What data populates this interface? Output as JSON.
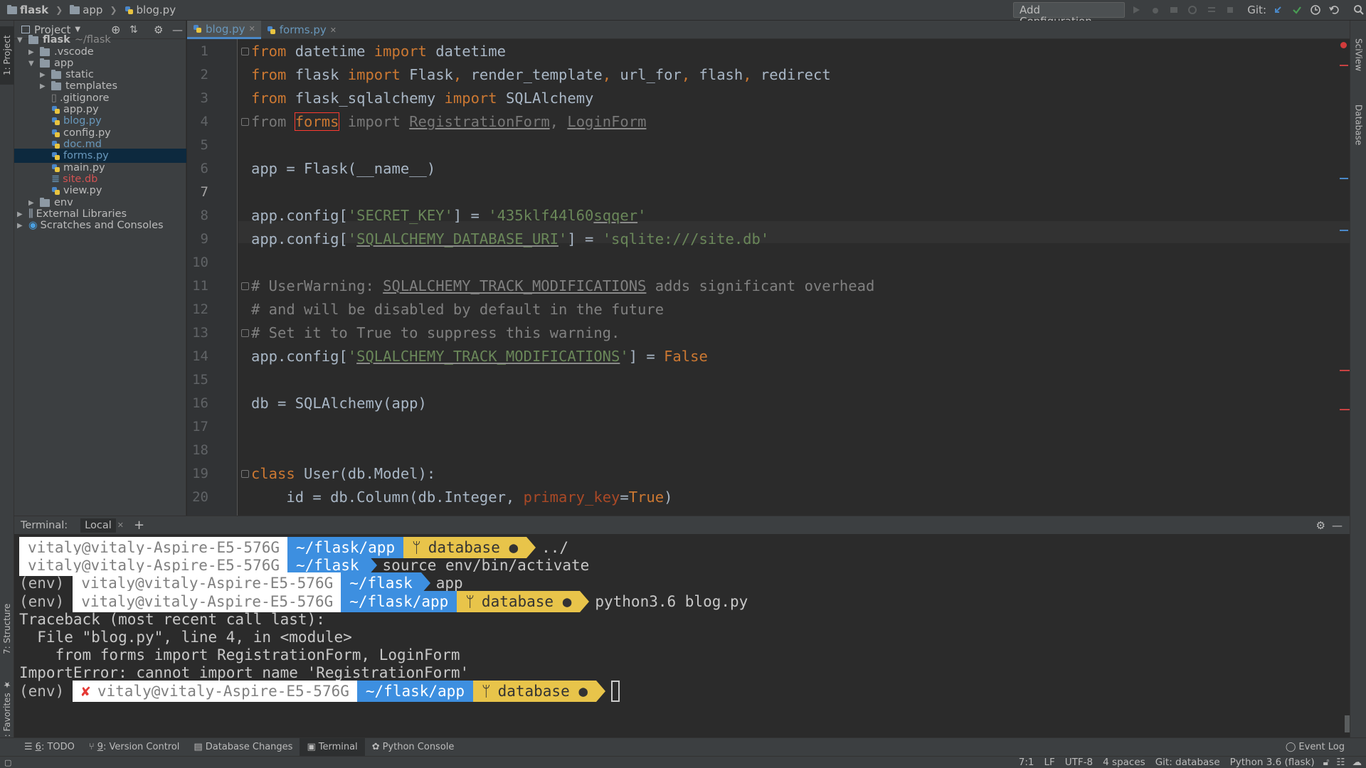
{
  "breadcrumb": {
    "root": "flask",
    "folder": "app",
    "file": "blog.py"
  },
  "nav": {
    "run_config": "Add Configuration...",
    "git_label": "Git:"
  },
  "project": {
    "header": "Project",
    "tree": [
      {
        "label": "flask",
        "suffix": "~/flask",
        "kind": "folder",
        "depth": 0,
        "expanded": true
      },
      {
        "label": ".vscode",
        "kind": "folder",
        "depth": 1,
        "expanded": false
      },
      {
        "label": "app",
        "kind": "folder",
        "depth": 1,
        "expanded": true
      },
      {
        "label": "static",
        "kind": "folder",
        "depth": 2,
        "expanded": false
      },
      {
        "label": "templates",
        "kind": "folder",
        "depth": 2,
        "expanded": false
      },
      {
        "label": ".gitignore",
        "kind": "file",
        "depth": 2
      },
      {
        "label": "app.py",
        "kind": "py",
        "depth": 2
      },
      {
        "label": "blog.py",
        "kind": "py",
        "depth": 2,
        "color": "#6897bb"
      },
      {
        "label": "config.py",
        "kind": "py",
        "depth": 2
      },
      {
        "label": "doc.md",
        "kind": "md",
        "depth": 2,
        "color": "#6897bb"
      },
      {
        "label": "forms.py",
        "kind": "py",
        "depth": 2,
        "color": "#6897bb",
        "selected": true
      },
      {
        "label": "main.py",
        "kind": "py",
        "depth": 2
      },
      {
        "label": "site.db",
        "kind": "db",
        "depth": 2,
        "color": "#d25252"
      },
      {
        "label": "view.py",
        "kind": "py",
        "depth": 2
      },
      {
        "label": "env",
        "kind": "folder",
        "depth": 1,
        "expanded": false
      },
      {
        "label": "External Libraries",
        "kind": "lib",
        "depth": 0,
        "expanded": false
      },
      {
        "label": "Scratches and Consoles",
        "kind": "scratch",
        "depth": 0,
        "expanded": false
      }
    ]
  },
  "tabs": [
    {
      "label": "blog.py",
      "active": true
    },
    {
      "label": "forms.py",
      "active": false
    }
  ],
  "editor": {
    "line_numbers": [
      "1",
      "2",
      "3",
      "4",
      "5",
      "6",
      "7",
      "8",
      "9",
      "10",
      "11",
      "12",
      "13",
      "14",
      "15",
      "16",
      "17",
      "18",
      "19",
      "20"
    ],
    "current_line": 7,
    "code": {
      "l1": [
        "from",
        " datetime ",
        "import",
        " datetime"
      ],
      "l2": [
        "from",
        " flask ",
        "import",
        " Flask",
        ",",
        " render_template",
        ",",
        " url_for",
        ",",
        " flash",
        ",",
        " redirect"
      ],
      "l3": [
        "from",
        " flask_sqlalchemy ",
        "import",
        " SQLAlchemy"
      ],
      "l4": [
        "from",
        " ",
        "forms",
        " import ",
        "RegistrationForm",
        ", ",
        "LoginForm"
      ],
      "l6": [
        "app = Flask(",
        "__name__",
        ")"
      ],
      "l8": [
        "app.config[",
        "'SECRET_KEY'",
        "] = ",
        "'435klf44l60",
        "sqqer",
        "'"
      ],
      "l9": [
        "app.config[",
        "'",
        "SQLALCHEMY_DATABASE_URI",
        "'",
        "] = ",
        "'sqlite:///site.db'"
      ],
      "l11": [
        "# UserWarning: ",
        "SQLALCHEMY_TRACK_MODIFICATIONS",
        " adds significant overhead"
      ],
      "l12": [
        "# and will be disabled by default in the future"
      ],
      "l13": [
        "# Set it to True to suppress this warning."
      ],
      "l14": [
        "app.config[",
        "'",
        "SQLALCHEMY_TRACK_MODIFICATIONS",
        "'",
        "] = ",
        "False"
      ],
      "l16": [
        "db = SQLAlchemy(app)"
      ],
      "l19": [
        "class",
        " User(db.Model):"
      ],
      "l20": [
        "    id = db.Column(db.Integer, ",
        "primary_key",
        "=",
        "True",
        ")"
      ]
    }
  },
  "terminal": {
    "title": "Terminal:",
    "tab": "Local",
    "rows": [
      {
        "env": "",
        "user": "vitaly@vitaly-Aspire-E5-576G",
        "path": "~/flask/app",
        "git": "database ●",
        "cmd": "../"
      },
      {
        "env": "",
        "user": "vitaly@vitaly-Aspire-E5-576G",
        "path": "~/flask",
        "git": "",
        "cmd": "source env/bin/activate"
      },
      {
        "env": "(env)",
        "user": "vitaly@vitaly-Aspire-E5-576G",
        "path": "~/flask",
        "git": "",
        "cmd": "app"
      },
      {
        "env": "(env)",
        "user": "vitaly@vitaly-Aspire-E5-576G",
        "path": "~/flask/app",
        "git": "database ●",
        "cmd": "python3.6 blog.py"
      }
    ],
    "output": [
      "Traceback (most recent call last):",
      "  File \"blog.py\", line 4, in <module>",
      "    from forms import RegistrationForm, LoginForm",
      "ImportError: cannot import name 'RegistrationForm'"
    ],
    "prompt": {
      "env": "(env)",
      "error_mark": "✘",
      "user": "vitaly@vitaly-Aspire-E5-576G",
      "path": "~/flask/app",
      "git": "database ●"
    }
  },
  "bottom_tools": [
    {
      "num": "6",
      "label": ": TODO"
    },
    {
      "num": "9",
      "label": ": Version Control"
    },
    {
      "num": "",
      "label": "Database Changes"
    },
    {
      "num": "",
      "label": "Terminal"
    },
    {
      "num": "",
      "label": "Python Console"
    }
  ],
  "event_log": "Event Log",
  "left_stripe": {
    "project": "1: Project",
    "structure": "7: Structure",
    "favorites": "2: Favorites"
  },
  "right_stripe": {
    "sciview": "SciView",
    "database": "Database"
  },
  "status": {
    "position": "7:1",
    "line_sep": "LF",
    "encoding": "UTF-8",
    "indent": "4 spaces",
    "git": "Git: database",
    "interpreter": "Python 3.6 (flask)"
  },
  "colors": {
    "accent": "#4a88c7",
    "keyword": "#cc7832",
    "string": "#6a8759",
    "error": "#ff3b30",
    "prompt_blue": "#3d8fe0",
    "prompt_yellow": "#e8c44a"
  }
}
